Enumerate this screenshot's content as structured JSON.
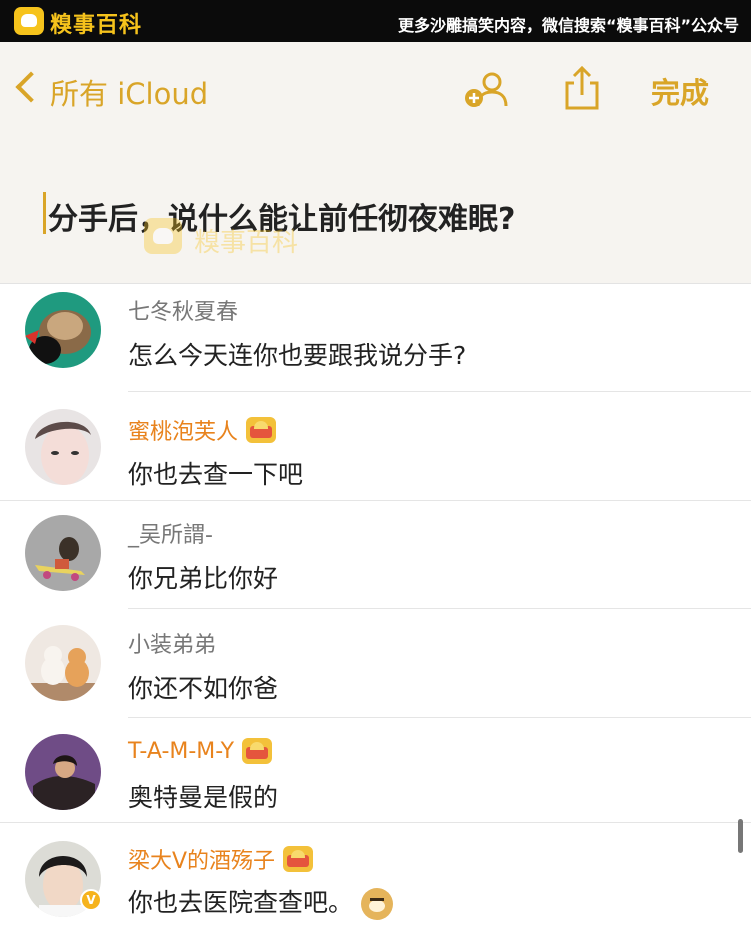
{
  "banner": {
    "logo_text": "糗事百科",
    "promo": "更多沙雕搞笑内容，微信搜索“糗事百科”公众号"
  },
  "notes_header": {
    "back_label": "所有 iCloud",
    "done_label": "完成",
    "note_title": "分手后，说什么能让前任彻夜难眠?",
    "watermark": "糗事百科"
  },
  "comments": [
    {
      "name": "七冬秋夏春",
      "text": "怎么今天连你也要跟我说分手?",
      "vip": false
    },
    {
      "name": "蜜桃泡芙人",
      "text": "你也去查一下吧",
      "vip": true
    },
    {
      "name": "_吴所謂-",
      "text": "你兄弟比你好",
      "vip": false
    },
    {
      "name": "小装弟弟",
      "text": "你还不如你爸",
      "vip": false
    },
    {
      "name": "T-A-M-M-Y",
      "text": "奥特曼是假的",
      "vip": true
    },
    {
      "name": "梁大V的酒殇子",
      "text": "你也去医院查查吧。",
      "vip": true,
      "verified": true,
      "emoji": "doge"
    }
  ],
  "icons": {
    "accent_color": "#d9a528",
    "vip_name_color": "#e8831d",
    "add_person": "add-person-icon",
    "share": "share-icon",
    "back": "chevron-left-icon",
    "vip": "vip-crown-icon",
    "verified": "verified-v-badge-icon",
    "verified_letter": "V"
  }
}
